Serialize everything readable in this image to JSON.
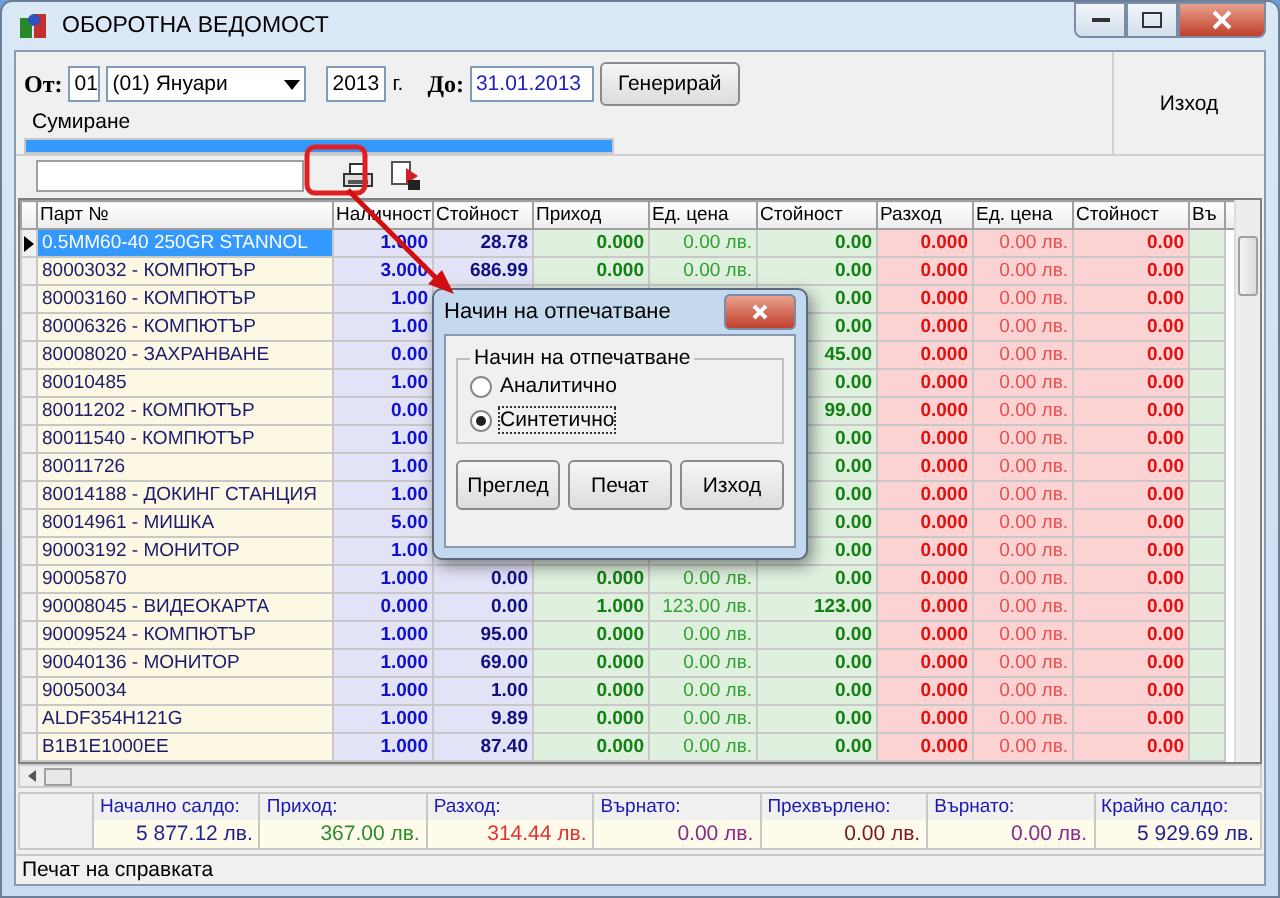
{
  "window": {
    "title": "ОБОРОТНА ВЕДОМОСТ"
  },
  "filter": {
    "from_label": "От:",
    "from_day": "01",
    "month": "(01) Януари",
    "year": "2013",
    "year_suffix": "г.",
    "to_label": "До:",
    "to_date": "31.01.2013",
    "generate_button": "Генерирай",
    "progress_label": "Сумиране",
    "progress": {
      "level": 1
    },
    "exit_button": "Изход"
  },
  "table": {
    "columns": [
      "Парт №",
      "Наличност",
      "Стойност",
      "Приход",
      "Ед. цена",
      "Стойност",
      "Разход",
      "Ед. цена",
      "Стойност",
      "Въ"
    ],
    "rows": [
      {
        "selected": true,
        "part": "0.5MM60-40 250GR STANNOL",
        "qty": "1.000",
        "value": "28.78",
        "in_qty": "0.000",
        "in_price": "0.00 лв.",
        "in_value": "0.00",
        "out_qty": "0.000",
        "out_price": "0.00 лв.",
        "out_value": "0.00"
      },
      {
        "selected": false,
        "part": "80003032 - КОМПЮТЪР",
        "qty": "3.000",
        "value": "686.99",
        "in_qty": "0.000",
        "in_price": "0.00 лв.",
        "in_value": "0.00",
        "out_qty": "0.000",
        "out_price": "0.00 лв.",
        "out_value": "0.00"
      },
      {
        "selected": false,
        "part": "80003160 - КОМПЮТЪР",
        "qty": "1.00",
        "in_value": "0.00",
        "out_qty": "0.000",
        "out_price": "0.00 лв.",
        "out_value": "0.00"
      },
      {
        "selected": false,
        "part": "80006326 - КОМПЮТЪР",
        "qty": "1.00",
        "in_value": "0.00",
        "out_qty": "0.000",
        "out_price": "0.00 лв.",
        "out_value": "0.00"
      },
      {
        "selected": false,
        "part": "80008020 - ЗАХРАНВАНЕ",
        "qty": "0.00",
        "in_value": "45.00",
        "out_qty": "0.000",
        "out_price": "0.00 лв.",
        "out_value": "0.00"
      },
      {
        "selected": false,
        "part": "80010485",
        "qty": "1.00",
        "in_value": "0.00",
        "out_qty": "0.000",
        "out_price": "0.00 лв.",
        "out_value": "0.00"
      },
      {
        "selected": false,
        "part": "80011202 - КОМПЮТЪР",
        "qty": "0.00",
        "in_value": "99.00",
        "out_qty": "0.000",
        "out_price": "0.00 лв.",
        "out_value": "0.00"
      },
      {
        "selected": false,
        "part": "80011540 - КОМПЮТЪР",
        "qty": "1.00",
        "in_value": "0.00",
        "out_qty": "0.000",
        "out_price": "0.00 лв.",
        "out_value": "0.00"
      },
      {
        "selected": false,
        "part": "80011726",
        "qty": "1.00",
        "in_value": "0.00",
        "out_qty": "0.000",
        "out_price": "0.00 лв.",
        "out_value": "0.00"
      },
      {
        "selected": false,
        "part": "80014188 - ДОКИНГ СТАНЦИЯ",
        "qty": "1.00",
        "in_value": "0.00",
        "out_qty": "0.000",
        "out_price": "0.00 лв.",
        "out_value": "0.00"
      },
      {
        "selected": false,
        "part": "80014961 - МИШКА",
        "qty": "5.00",
        "in_value": "0.00",
        "out_qty": "0.000",
        "out_price": "0.00 лв.",
        "out_value": "0.00"
      },
      {
        "selected": false,
        "part": "90003192 - МОНИТОР",
        "qty": "1.00",
        "in_value": "0.00",
        "out_qty": "0.000",
        "out_price": "0.00 лв.",
        "out_value": "0.00"
      },
      {
        "selected": false,
        "part": "90005870",
        "qty": "1.000",
        "value": "0.00",
        "in_qty": "0.000",
        "in_price": "0.00 лв.",
        "in_value": "0.00",
        "out_qty": "0.000",
        "out_price": "0.00 лв.",
        "out_value": "0.00"
      },
      {
        "selected": false,
        "part": "90008045 - ВИДЕОКАРТА",
        "qty": "0.000",
        "value": "0.00",
        "in_qty": "1.000",
        "in_price": "123.00 лв.",
        "in_value": "123.00",
        "out_qty": "0.000",
        "out_price": "0.00 лв.",
        "out_value": "0.00"
      },
      {
        "selected": false,
        "part": "90009524 - КОМПЮТЪР",
        "qty": "1.000",
        "value": "95.00",
        "in_qty": "0.000",
        "in_price": "0.00 лв.",
        "in_value": "0.00",
        "out_qty": "0.000",
        "out_price": "0.00 лв.",
        "out_value": "0.00"
      },
      {
        "selected": false,
        "part": "90040136 - МОНИТОР",
        "qty": "1.000",
        "value": "69.00",
        "in_qty": "0.000",
        "in_price": "0.00 лв.",
        "in_value": "0.00",
        "out_qty": "0.000",
        "out_price": "0.00 лв.",
        "out_value": "0.00"
      },
      {
        "selected": false,
        "part": "90050034",
        "qty": "1.000",
        "value": "1.00",
        "in_qty": "0.000",
        "in_price": "0.00 лв.",
        "in_value": "0.00",
        "out_qty": "0.000",
        "out_price": "0.00 лв.",
        "out_value": "0.00"
      },
      {
        "selected": false,
        "part": "ALDF354H121G",
        "qty": "1.000",
        "value": "9.89",
        "in_qty": "0.000",
        "in_price": "0.00 лв.",
        "in_value": "0.00",
        "out_qty": "0.000",
        "out_price": "0.00 лв.",
        "out_value": "0.00"
      },
      {
        "selected": false,
        "part": "B1B1E1000EE",
        "qty": "1.000",
        "value": "87.40",
        "in_qty": "0.000",
        "in_price": "0.00 лв.",
        "in_value": "0.00",
        "out_qty": "0.000",
        "out_price": "0.00 лв.",
        "out_value": "0.00"
      }
    ]
  },
  "totals": [
    {
      "label": "Начално салдо:",
      "value": "5 877.12 лв.",
      "color": "#1f1f8f"
    },
    {
      "label": "Приход:",
      "value": "367.00 лв.",
      "color": "#2e8b2e"
    },
    {
      "label": "Разход:",
      "value": "314.44 лв.",
      "color": "#e03030"
    },
    {
      "label": "Върнато:",
      "value": "0.00 лв.",
      "color": "#8a2a8a"
    },
    {
      "label": "Прехвърлено:",
      "value": "0.00 лв.",
      "color": "#7a1a1a"
    },
    {
      "label": "Върнато:",
      "value": "0.00 лв.",
      "color": "#8a2a8a"
    },
    {
      "label": "Крайно салдо:",
      "value": "5 929.69 лв.",
      "color": "#1f1f8f"
    }
  ],
  "status_bar": "Печат на справката",
  "dialog": {
    "title": "Начин на отпечатване",
    "group_label": "Начин на отпечатване",
    "options": [
      {
        "label": "Аналитично",
        "selected": false
      },
      {
        "label": "Синтетично",
        "selected": true
      }
    ],
    "buttons": [
      "Преглед",
      "Печат",
      "Изход"
    ]
  }
}
